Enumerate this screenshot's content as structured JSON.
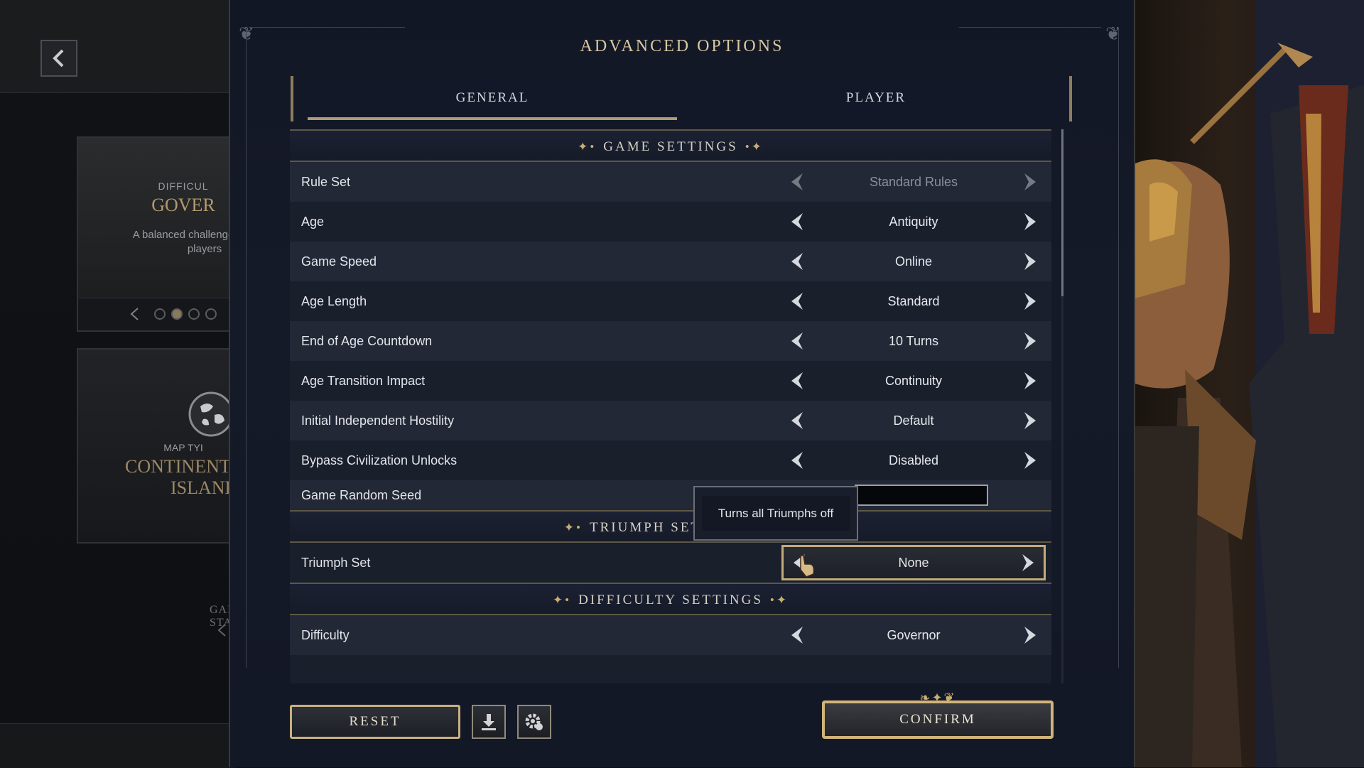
{
  "panel": {
    "title": "ADVANCED OPTIONS"
  },
  "tabs": [
    {
      "label": "GENERAL",
      "selected": true
    },
    {
      "label": "PLAYER",
      "selected": false
    }
  ],
  "background": {
    "difficulty_card": {
      "caption": "DIFFICUL",
      "title": "GOVER",
      "description_line1": "A balanced challenge",
      "description_line2": "players"
    },
    "map_card": {
      "caption": "MAP TYI",
      "title_line1": "CONTINENTS AN",
      "title_line2": "ISLANDS"
    },
    "game_start_label": "GAME STAR"
  },
  "sections": {
    "game": {
      "header": "GAME SETTINGS",
      "rows": [
        {
          "label": "Rule Set",
          "value": "Standard Rules",
          "disabled": true
        },
        {
          "label": "Age",
          "value": "Antiquity"
        },
        {
          "label": "Game Speed",
          "value": "Online"
        },
        {
          "label": "Age Length",
          "value": "Standard"
        },
        {
          "label": "End of Age Countdown",
          "value": "10 Turns"
        },
        {
          "label": "Age Transition Impact",
          "value": "Continuity"
        },
        {
          "label": "Initial Independent Hostility",
          "value": "Default"
        },
        {
          "label": "Bypass Civilization Unlocks",
          "value": "Disabled"
        }
      ],
      "seed": {
        "label": "Game Random Seed",
        "value": ""
      }
    },
    "triumph": {
      "header": "TRIUMPH SETTINGS",
      "rows": [
        {
          "label": "Triumph Set",
          "value": "None",
          "focused": true
        }
      ]
    },
    "difficulty": {
      "header": "DIFFICULTY SETTINGS",
      "rows": [
        {
          "label": "Difficulty",
          "value": "Governor"
        }
      ]
    }
  },
  "tooltip": {
    "text": "Turns all Triumphs off"
  },
  "buttons": {
    "reset": "RESET",
    "confirm": "CONFIRM",
    "download_icon": "download-icon",
    "settings_icon": "gear-icon"
  },
  "colors": {
    "accent_gold": "#c8ad73",
    "panel_bg": "#151a28",
    "row_odd": "#232836",
    "row_even": "#1a1f2c"
  }
}
